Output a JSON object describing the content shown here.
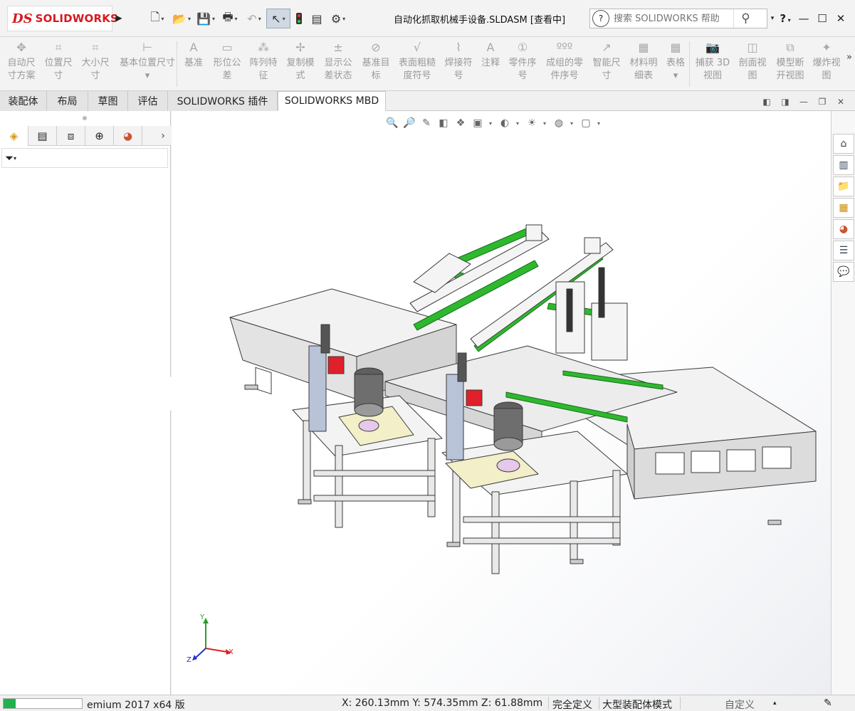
{
  "app": {
    "logo_prefix": "DS",
    "logo_text": "SOLIDWORKS",
    "document_title": "自动化抓取机械手设备.SLDASM [查看中]"
  },
  "search": {
    "placeholder": "搜索 SOLIDWORKS 帮助"
  },
  "quick_access": [
    {
      "name": "new-document-icon",
      "glyph": "🗋"
    },
    {
      "name": "open-document-icon",
      "glyph": "📂"
    },
    {
      "name": "save-icon",
      "glyph": "💾"
    },
    {
      "name": "print-icon",
      "glyph": "🖶"
    },
    {
      "name": "undo-icon",
      "glyph": "↶"
    },
    {
      "name": "select-icon",
      "glyph": "↖"
    },
    {
      "name": "rebuild-icon",
      "glyph": "🚦"
    },
    {
      "name": "file-properties-icon",
      "glyph": "▤"
    },
    {
      "name": "options-icon",
      "glyph": "⚙"
    }
  ],
  "help_glyph": "?",
  "ribbon": {
    "tools": [
      {
        "label1": "自动尺",
        "label2": "寸方案",
        "glyph": "✥"
      },
      {
        "label1": "位置尺",
        "label2": "寸",
        "glyph": "⌗"
      },
      {
        "label1": "大小尺",
        "label2": "寸",
        "glyph": "⌗"
      },
      {
        "label1": "基本位置尺寸",
        "label2": "▾",
        "glyph": "⊢"
      },
      {
        "label1": "基准",
        "label2": "",
        "glyph": "A"
      },
      {
        "label1": "形位公",
        "label2": "差",
        "glyph": "▭"
      },
      {
        "label1": "阵列特",
        "label2": "征",
        "glyph": "⁂"
      },
      {
        "label1": "复制模",
        "label2": "式",
        "glyph": "✢"
      },
      {
        "label1": "显示公",
        "label2": "差状态",
        "glyph": "±"
      },
      {
        "label1": "基准目",
        "label2": "标",
        "glyph": "⊘"
      },
      {
        "label1": "表面粗糙",
        "label2": "度符号",
        "glyph": "√"
      },
      {
        "label1": "焊接符",
        "label2": "号",
        "glyph": "⌇"
      },
      {
        "label1": "注释",
        "label2": "",
        "glyph": "A"
      },
      {
        "label1": "零件序",
        "label2": "号",
        "glyph": "①"
      },
      {
        "label1": "成组的零",
        "label2": "件序号",
        "glyph": "ººº"
      },
      {
        "label1": "智能尺",
        "label2": "寸",
        "glyph": "↗"
      },
      {
        "label1": "材料明",
        "label2": "细表",
        "glyph": "▦"
      },
      {
        "label1": "表格",
        "label2": "▾",
        "glyph": "▦"
      },
      {
        "label1": "捕获 3D",
        "label2": "视图",
        "glyph": "📷"
      },
      {
        "label1": "剖面视",
        "label2": "图",
        "glyph": "◫"
      },
      {
        "label1": "模型断",
        "label2": "开视图",
        "glyph": "⧉"
      },
      {
        "label1": "爆炸视",
        "label2": "图",
        "glyph": "✦"
      }
    ],
    "more": "»"
  },
  "tabs": [
    "装配体",
    "布局",
    "草图",
    "评估",
    "SOLIDWORKS 插件",
    "SOLIDWORKS MBD"
  ],
  "left_panel": {
    "tabs": [
      {
        "name": "featuremanager-tab",
        "glyph": "◈"
      },
      {
        "name": "propertymanager-tab",
        "glyph": "▤"
      },
      {
        "name": "configurationmanager-tab",
        "glyph": "⧈"
      },
      {
        "name": "dimxpertmanager-tab",
        "glyph": "⊕"
      },
      {
        "name": "displaymanager-tab",
        "glyph": "◕"
      }
    ],
    "more": "›",
    "filter_glyph": "⏷"
  },
  "heads_up": [
    "🔍",
    "🔎",
    "✎",
    "◧",
    "❖",
    "▣",
    "◐",
    "☀",
    "◍",
    "▢"
  ],
  "task_pane": [
    {
      "name": "home-icon",
      "glyph": "⌂"
    },
    {
      "name": "design-library-icon",
      "glyph": "▥"
    },
    {
      "name": "file-explorer-icon",
      "glyph": "📁"
    },
    {
      "name": "view-palette-icon",
      "glyph": "▦"
    },
    {
      "name": "appearances-icon",
      "glyph": "◕"
    },
    {
      "name": "custom-properties-icon",
      "glyph": "☰"
    },
    {
      "name": "forum-icon",
      "glyph": "💬"
    }
  ],
  "triad": {
    "x": "X",
    "y": "Y",
    "z": "Z"
  },
  "status": {
    "progress": 0.15,
    "product": "emium 2017 x64 版",
    "coordinates": "X: 260.13mm Y: 574.35mm Z: 61.88mm",
    "definition": "完全定义",
    "mode": "大型装配体模式",
    "units": "自定义",
    "units_dd": "▴"
  },
  "colors": {
    "accent_red": "#d71920",
    "linear_rail_green": "#2eb82e",
    "frame_gray": "#e6e6e6",
    "motor_gray": "#6e6e6e",
    "cylinder_red": "#e0202a",
    "plate_yellow": "#f2efc9"
  }
}
